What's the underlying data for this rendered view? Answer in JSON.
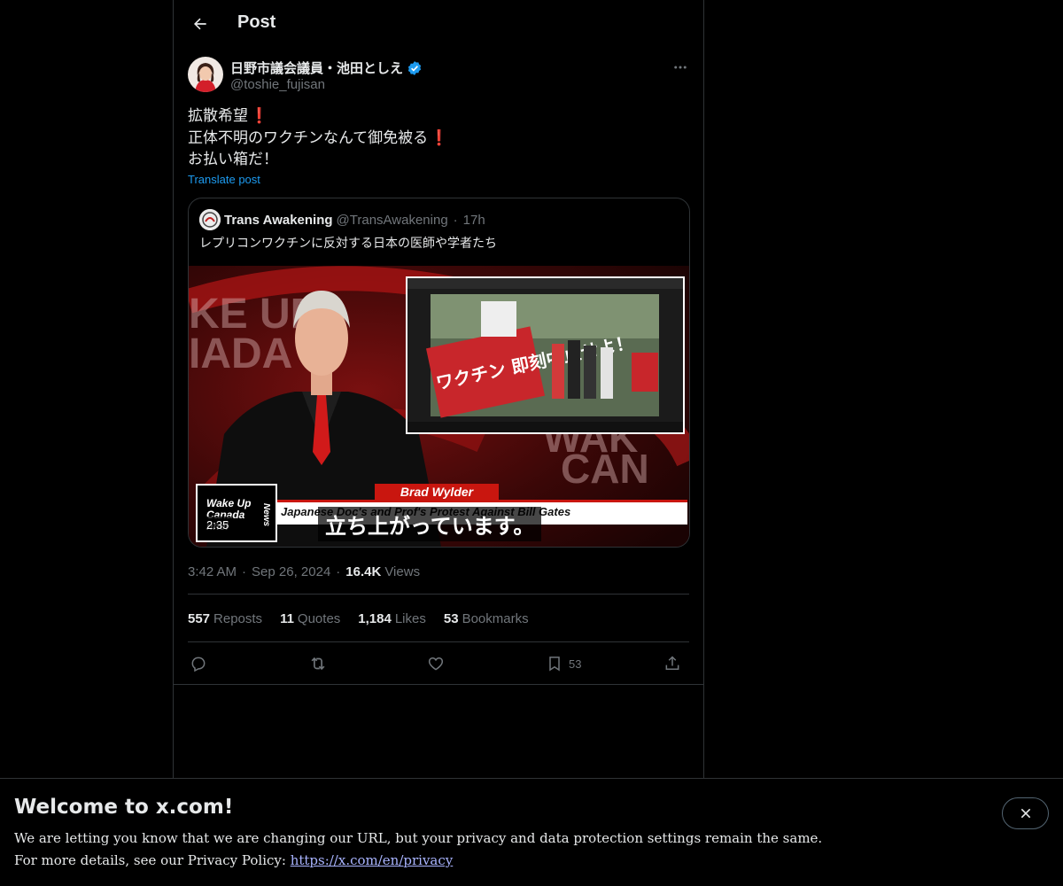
{
  "header": {
    "title": "Post"
  },
  "author": {
    "name": "日野市議会議員・池田としえ",
    "handle": "@toshie_fujisan"
  },
  "post": {
    "lines": [
      "拡散希望",
      "正体不明のワクチンなんて御免被る",
      "お払い箱だ！"
    ],
    "line_marks": [
      "❗",
      "❗",
      ""
    ],
    "translate_label": "Translate post"
  },
  "quote": {
    "name": "Trans Awakening",
    "handle": "@TransAwakening",
    "separator": "·",
    "time": "17h",
    "text": "レプリコンワクチンに反対する日本の医師や学者たち",
    "video": {
      "duration": "2:35",
      "subtitle": "立ち上がっています。",
      "nameplate": "Brad Wylder",
      "lower_third": "Japanese Doc's and Prof's Protest Against Bill Gates",
      "brand_line1": "Wake Up",
      "brand_line2": "Canada",
      "brand_line3": "nnel",
      "brand_news": "News",
      "sign_text": "ワクチン 即刻中止せよ！"
    }
  },
  "meta": {
    "time": "3:42 AM",
    "separator": "·",
    "date": "Sep 26, 2024",
    "views_count": "16.4K",
    "views_label": "Views"
  },
  "stats": {
    "reposts_count": "557",
    "reposts_label": "Reposts",
    "quotes_count": "11",
    "quotes_label": "Quotes",
    "likes_count": "1,184",
    "likes_label": "Likes",
    "bookmarks_count": "53",
    "bookmarks_label": "Bookmarks"
  },
  "actions": {
    "bookmark_count": "53"
  },
  "banner": {
    "title": "Welcome to x.com!",
    "line1": "We are letting you know that we are changing our URL, but your privacy and data protection settings remain the same.",
    "line2_prefix": "For more details, see our Privacy Policy: ",
    "link": "https://x.com/en/privacy"
  },
  "colors": {
    "accent": "#1d9bf0",
    "background": "#000000",
    "muted": "#71767b",
    "border": "#2f3336"
  }
}
